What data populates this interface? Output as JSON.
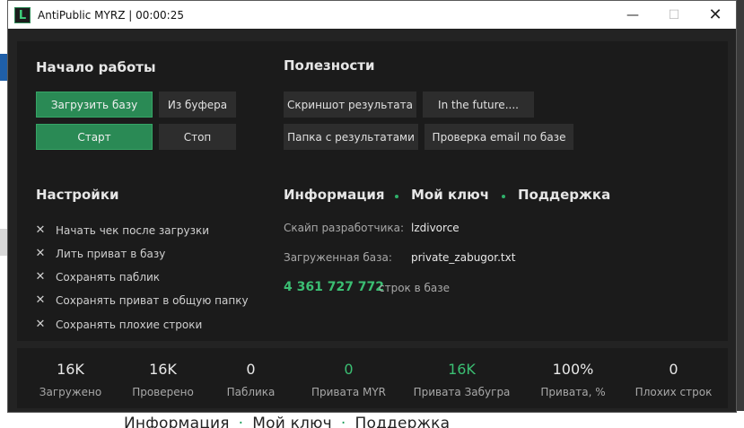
{
  "window": {
    "title": "AntiPublic MYRZ | 00:00:25",
    "icon_letter": "L",
    "controls": {
      "minimize": "—",
      "maximize": "☐",
      "close": "✕"
    }
  },
  "background": {
    "ghost_items": [
      "Информация",
      "Мой ключ",
      "Поддержка"
    ]
  },
  "start": {
    "title": "Начало работы",
    "load_db": "Загрузить базу",
    "from_buffer": "Из буфера",
    "start": "Старт",
    "stop": "Стоп"
  },
  "utilities": {
    "title": "Полезности",
    "screenshot": "Скриншот результата",
    "future": "In the future....",
    "results_folder": "Папка с результатами",
    "check_email": "Проверка email по базе"
  },
  "settings": {
    "title": "Настройки",
    "options": [
      "Начать чек после загрузки",
      "Лить приват в базу",
      "Сохранять паблик",
      "Сохранять приват в общую папку",
      "Сохранять плохие строки"
    ],
    "option_mark": "✕"
  },
  "info": {
    "nav": [
      "Информация",
      "Мой ключ",
      "Поддержка"
    ],
    "dev_skype_label": "Скайп разработчика:",
    "dev_skype_value": "lzdivorce",
    "loaded_db_label": "Загруженная база:",
    "loaded_db_value": "private_zabugor.txt",
    "rows_count": "4 361 727 772",
    "rows_suffix": "строк в базе"
  },
  "stats": [
    {
      "value": "16K",
      "label": "Загружено"
    },
    {
      "value": "16K",
      "label": "Проверено"
    },
    {
      "value": "0",
      "label": "Паблика"
    },
    {
      "value": "0",
      "label": "Привата MYR"
    },
    {
      "value": "16K",
      "label": "Привата Забугра"
    },
    {
      "value": "100%",
      "label": "Привата, %"
    },
    {
      "value": "0",
      "label": "Плохих строк"
    }
  ],
  "colors": {
    "accent_green": "#2a8a55",
    "value_green": "#3bbf73",
    "panel": "#1b1b1b",
    "window_bg": "#232323"
  }
}
